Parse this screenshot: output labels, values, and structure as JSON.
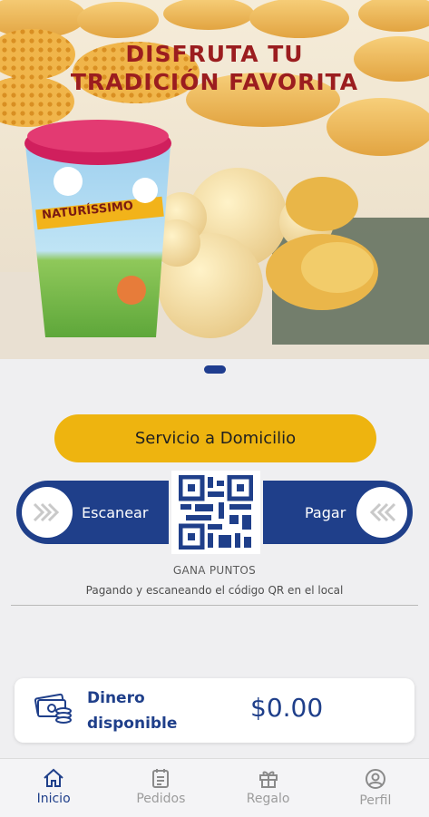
{
  "banner": {
    "title_line1": "DISFRUTA TU",
    "title_line2": "TRADICIÓN FAVORITA",
    "cup_brand": "NATURÍSSIMO",
    "slide_count": 1
  },
  "actions": {
    "delivery_label": "Servicio a Domicilio",
    "scan_label": "Escanear",
    "pay_label": "Pagar"
  },
  "points": {
    "heading": "GANA PUNTOS",
    "description": "Pagando y escaneando el código QR en el local"
  },
  "wallet": {
    "label": "Dinero disponible",
    "amount": "$0.00"
  },
  "nav": [
    {
      "label": "Inicio",
      "icon": "home-icon",
      "active": true
    },
    {
      "label": "Pedidos",
      "icon": "list-icon",
      "active": false
    },
    {
      "label": "Regalo",
      "icon": "gift-icon",
      "active": false
    },
    {
      "label": "Perfil",
      "icon": "user-icon",
      "active": false
    }
  ],
  "colors": {
    "brand_blue": "#1f3f8a",
    "accent_yellow": "#eeb40f",
    "title_red": "#9b1d1f"
  }
}
